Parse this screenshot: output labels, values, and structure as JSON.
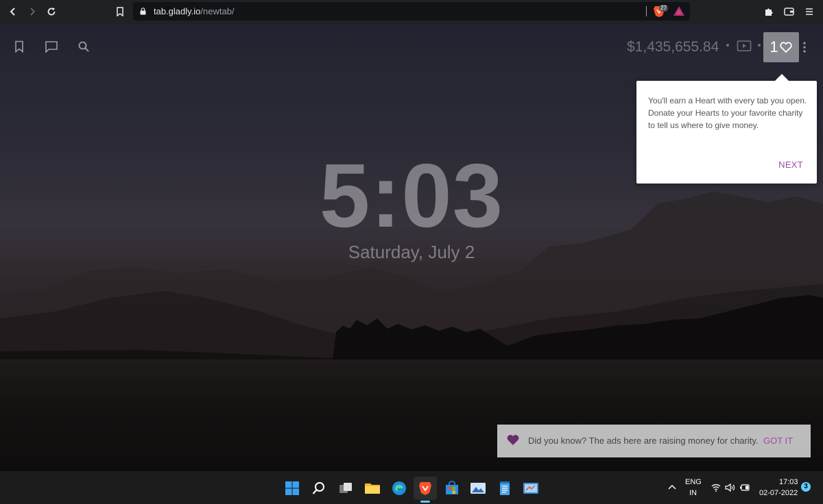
{
  "browser": {
    "url_domain": "tab.gladly.io",
    "url_path": "/newtab/",
    "shield_count": "27"
  },
  "newtab": {
    "money_raised": "$1,435,655.84",
    "hearts_count": "1",
    "clock_time": "5:03",
    "clock_date": "Saturday, July 2"
  },
  "tooltip": {
    "text": "You'll earn a Heart with every tab you open. Donate your Hearts to your favorite charity to tell us where to give money.",
    "next_label": "NEXT"
  },
  "charity_notice": {
    "text": "Did you know? The ads here are raising money for charity.",
    "button_label": "GOT IT"
  },
  "taskbar": {
    "language_top": "ENG",
    "language_bottom": "IN",
    "time": "17:03",
    "date": "02-07-2022",
    "notification_count": "3"
  },
  "colors": {
    "accent_purple": "#9d4ba3",
    "windows_blue": "#60cdff",
    "brave_orange": "#fb542b"
  }
}
